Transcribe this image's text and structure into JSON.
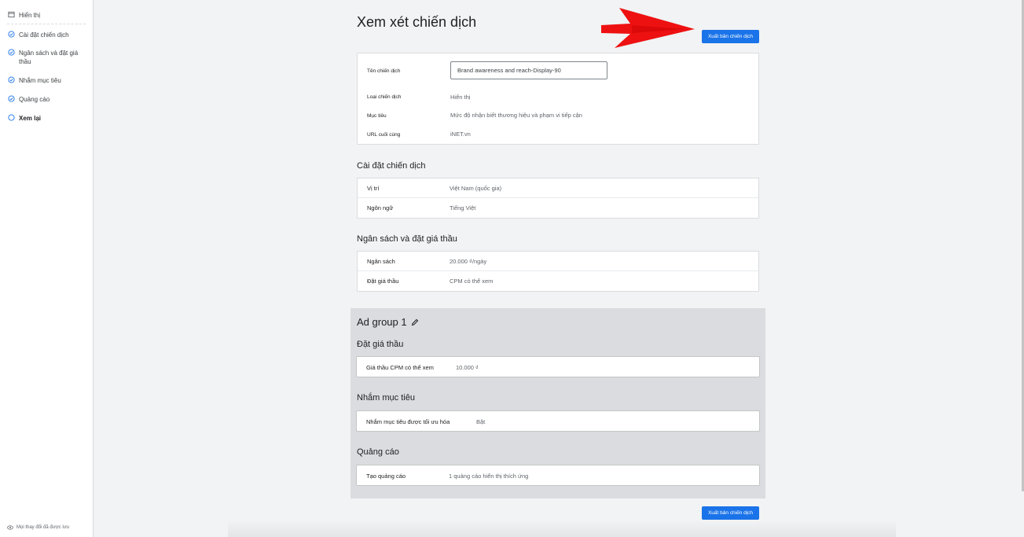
{
  "sidebar": {
    "items": [
      {
        "label": "Hiển thị",
        "icon": "display-icon"
      },
      {
        "label": "Cài đặt chiến dịch",
        "icon": "check-circle-icon"
      },
      {
        "label": "Ngân sách và đặt giá thầu",
        "icon": "check-circle-icon"
      },
      {
        "label": "Nhắm mục tiêu",
        "icon": "check-circle-icon"
      },
      {
        "label": "Quảng cáo",
        "icon": "check-circle-icon"
      },
      {
        "label": "Xem lại",
        "icon": "empty-circle-icon"
      }
    ],
    "footer": "Mọi thay đổi đã được lưu"
  },
  "header": {
    "title": "Xem xét chiến dịch",
    "publish_label": "Xuất bản chiến dịch"
  },
  "info": {
    "name_label": "Tên chiến dịch",
    "name_value": "Brand awareness and reach-Display-90",
    "type_label": "Loại chiến dịch",
    "type_value": "Hiển thị",
    "goal_label": "Mục tiêu",
    "goal_value": "Mức độ nhận biết thương hiệu và phạm vi tiếp cận",
    "url_label": "URL cuối cùng",
    "url_value": "iNET.vn"
  },
  "settings": {
    "title": "Cài đặt chiến dịch",
    "rows": [
      {
        "label": "Vị trí",
        "value": "Việt Nam (quốc gia)"
      },
      {
        "label": "Ngôn ngữ",
        "value": "Tiếng Việt"
      }
    ]
  },
  "budget": {
    "title": "Ngân sách và đặt giá thầu",
    "rows": [
      {
        "label": "Ngân sách",
        "value": "20.000 ₫/ngày"
      },
      {
        "label": "Đặt giá thầu",
        "value": "CPM có thể xem"
      }
    ]
  },
  "ad_group": {
    "title": "Ad group 1",
    "bid_title": "Đặt giá thầu",
    "bid_label": "Giá thầu CPM có thể xem",
    "bid_value": "10.000 ₫",
    "targeting_title": "Nhắm mục tiêu",
    "targeting_label": "Nhắm mục tiêu được tối ưu hóa",
    "targeting_value": "Bật",
    "ads_title": "Quảng cáo",
    "ads_label": "Tạo quảng cáo",
    "ads_value": "1 quảng cáo hiển thị thích ứng"
  },
  "colors": {
    "primary": "#1a73e8",
    "annotation_arrow": "#ee1111"
  }
}
